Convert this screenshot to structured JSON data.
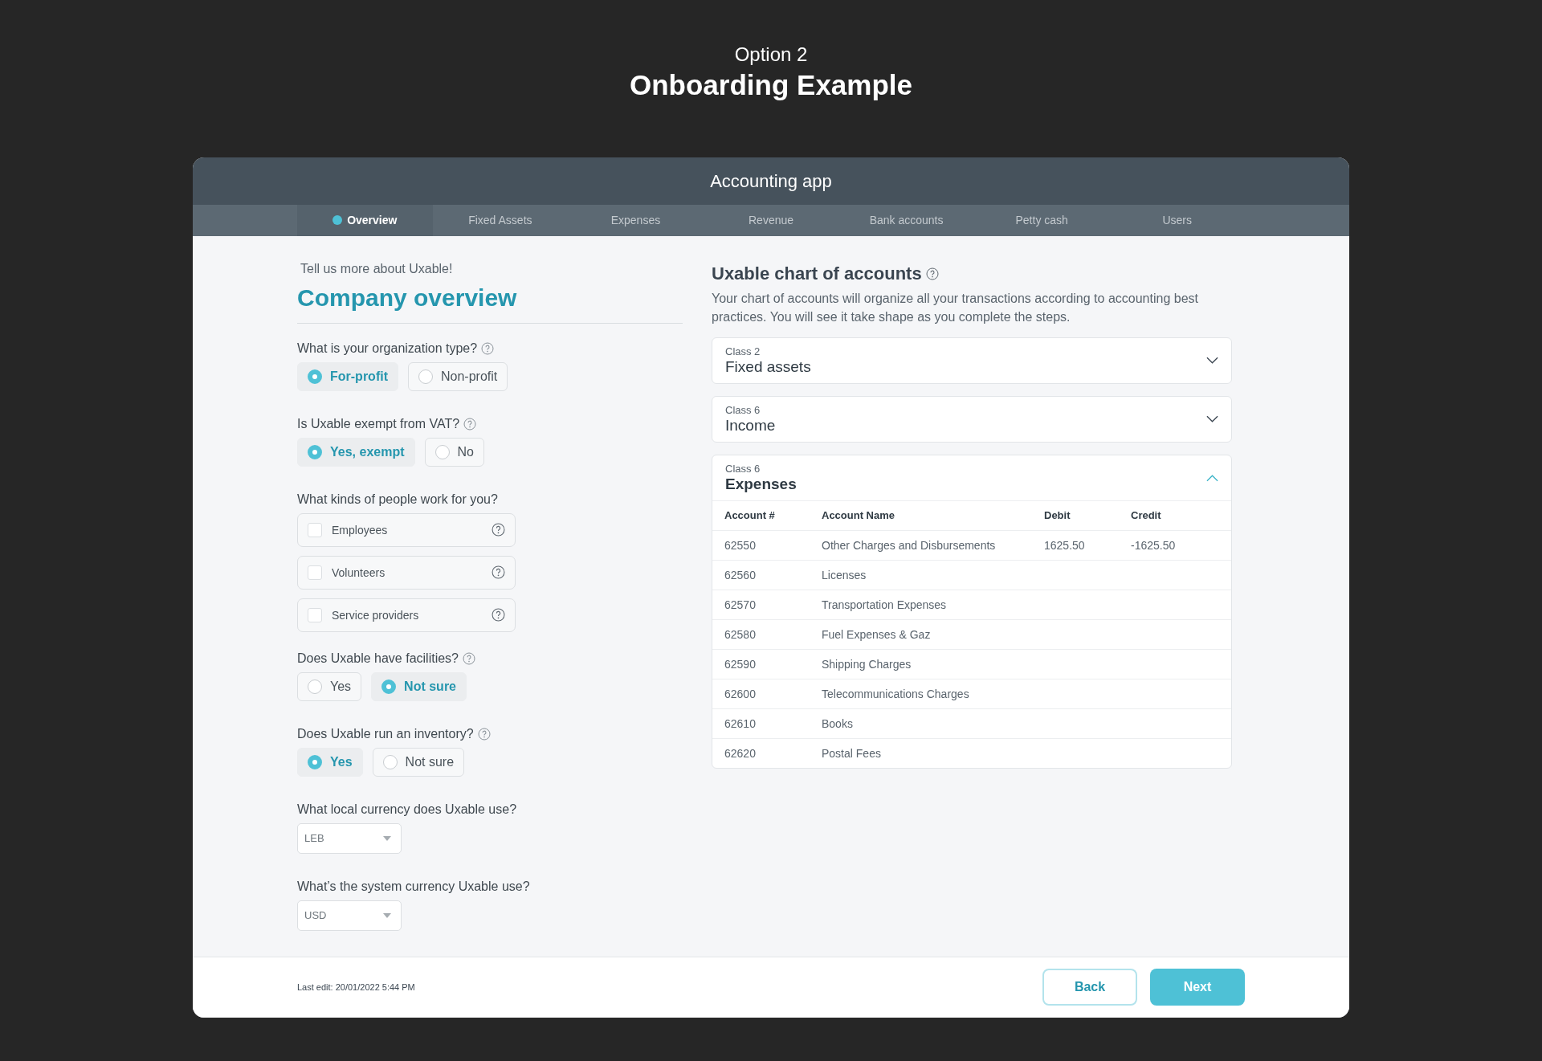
{
  "header": {
    "subtitle": "Option 2",
    "title": "Onboarding Example"
  },
  "app": {
    "title": "Accounting app",
    "tabs": [
      {
        "label": "Overview",
        "selected": true
      },
      {
        "label": "Fixed Assets",
        "selected": false
      },
      {
        "label": "Expenses",
        "selected": false
      },
      {
        "label": "Revenue",
        "selected": false
      },
      {
        "label": "Bank accounts",
        "selected": false
      },
      {
        "label": "Petty cash",
        "selected": false
      },
      {
        "label": "Users",
        "selected": false
      }
    ]
  },
  "form": {
    "eyebrow": "Tell us more about Uxable!",
    "title": "Company overview",
    "questions": [
      {
        "kind": "radio",
        "label": "What is your organization type?",
        "help": true,
        "options": [
          {
            "label": "For-profit",
            "selected": true
          },
          {
            "label": "Non-profit",
            "selected": false
          }
        ]
      },
      {
        "kind": "radio",
        "label": "Is Uxable exempt from VAT?",
        "help": true,
        "options": [
          {
            "label": "Yes, exempt",
            "selected": true
          },
          {
            "label": "No",
            "selected": false
          }
        ]
      },
      {
        "kind": "checkbox",
        "label": "What kinds of people work for you?",
        "help": false,
        "options": [
          {
            "label": "Employees",
            "checked": false
          },
          {
            "label": "Volunteers",
            "checked": false
          },
          {
            "label": "Service providers",
            "checked": false
          }
        ]
      },
      {
        "kind": "radio",
        "label": "Does Uxable have facilities?",
        "help": true,
        "options": [
          {
            "label": "Yes",
            "selected": false
          },
          {
            "label": "Not sure",
            "selected": true
          }
        ]
      },
      {
        "kind": "radio",
        "label": "Does Uxable run an inventory?",
        "help": true,
        "options": [
          {
            "label": "Yes",
            "selected": true
          },
          {
            "label": "Not sure",
            "selected": false
          }
        ]
      },
      {
        "kind": "select",
        "label": "What local currency does Uxable use?",
        "help": false,
        "value": "LEB"
      },
      {
        "kind": "select",
        "label": "What’s the system currency Uxable use?",
        "help": false,
        "value": "USD"
      }
    ]
  },
  "chart": {
    "title": "Uxable chart of accounts",
    "description": "Your chart of accounts will organize all your transactions according to accounting best practices. You will see it take shape as you complete the steps.",
    "groups": [
      {
        "class": "Class 2",
        "name": "Fixed assets",
        "expanded": false
      },
      {
        "class": "Class 6",
        "name": "Income",
        "expanded": false
      },
      {
        "class": "Class 6",
        "name": "Expenses",
        "expanded": true,
        "columns": [
          "Account #",
          "Account Name",
          "Debit",
          "Credit"
        ],
        "rows": [
          [
            "62550",
            "Other Charges and Disbursements",
            "1625.50",
            "-1625.50"
          ],
          [
            "62560",
            "Licenses",
            "",
            ""
          ],
          [
            "62570",
            "Transportation Expenses",
            "",
            ""
          ],
          [
            "62580",
            "Fuel Expenses & Gaz",
            "",
            ""
          ],
          [
            "62590",
            "Shipping Charges",
            "",
            ""
          ],
          [
            "62600",
            "Telecommunications Charges",
            "",
            ""
          ],
          [
            "62610",
            "Books",
            "",
            ""
          ],
          [
            "62620",
            "Postal Fees",
            "",
            ""
          ]
        ]
      }
    ]
  },
  "footer": {
    "last_edit": "Last edit: 20/01/2022 5:44 PM",
    "buttons": [
      {
        "label": "Back",
        "kind": "secondary"
      },
      {
        "label": "Next",
        "kind": "primary"
      }
    ]
  }
}
